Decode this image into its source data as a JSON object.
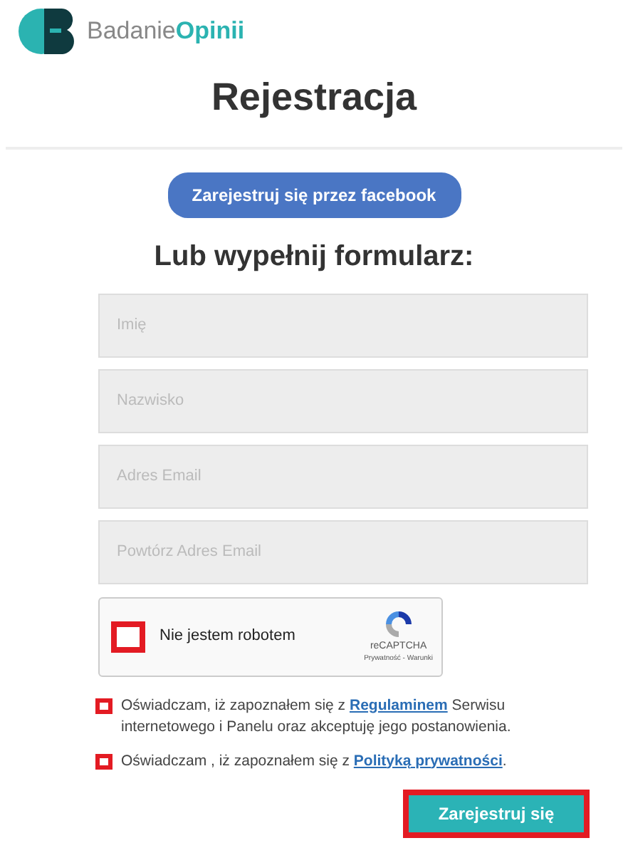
{
  "logo": {
    "word_1": "Badanie",
    "word_2": "Opinii"
  },
  "title": "Rejestracja",
  "facebook_button": "Zarejestruj się przez facebook",
  "subtitle": "Lub wypełnij formularz:",
  "fields": [
    {
      "placeholder": "Imię"
    },
    {
      "placeholder": "Nazwisko"
    },
    {
      "placeholder": "Adres Email"
    },
    {
      "placeholder": "Powtórz Adres Email"
    }
  ],
  "captcha": {
    "label": "Nie jestem robotem",
    "checked": false,
    "brand": "reCAPTCHA",
    "links": "Prywatność - Warunki"
  },
  "consents": [
    {
      "before": "Oświadczam, iż zapoznałem się z ",
      "link": "Regulaminem",
      "after": " Serwisu internetowego i Panelu oraz akceptuję jego postanowienia.",
      "error": true
    },
    {
      "before": "Oświadczam , iż zapoznałem się z ",
      "link": "Polityką prywatności",
      "after": ".",
      "error": true
    }
  ],
  "submit_button": "Zarejestruj się"
}
